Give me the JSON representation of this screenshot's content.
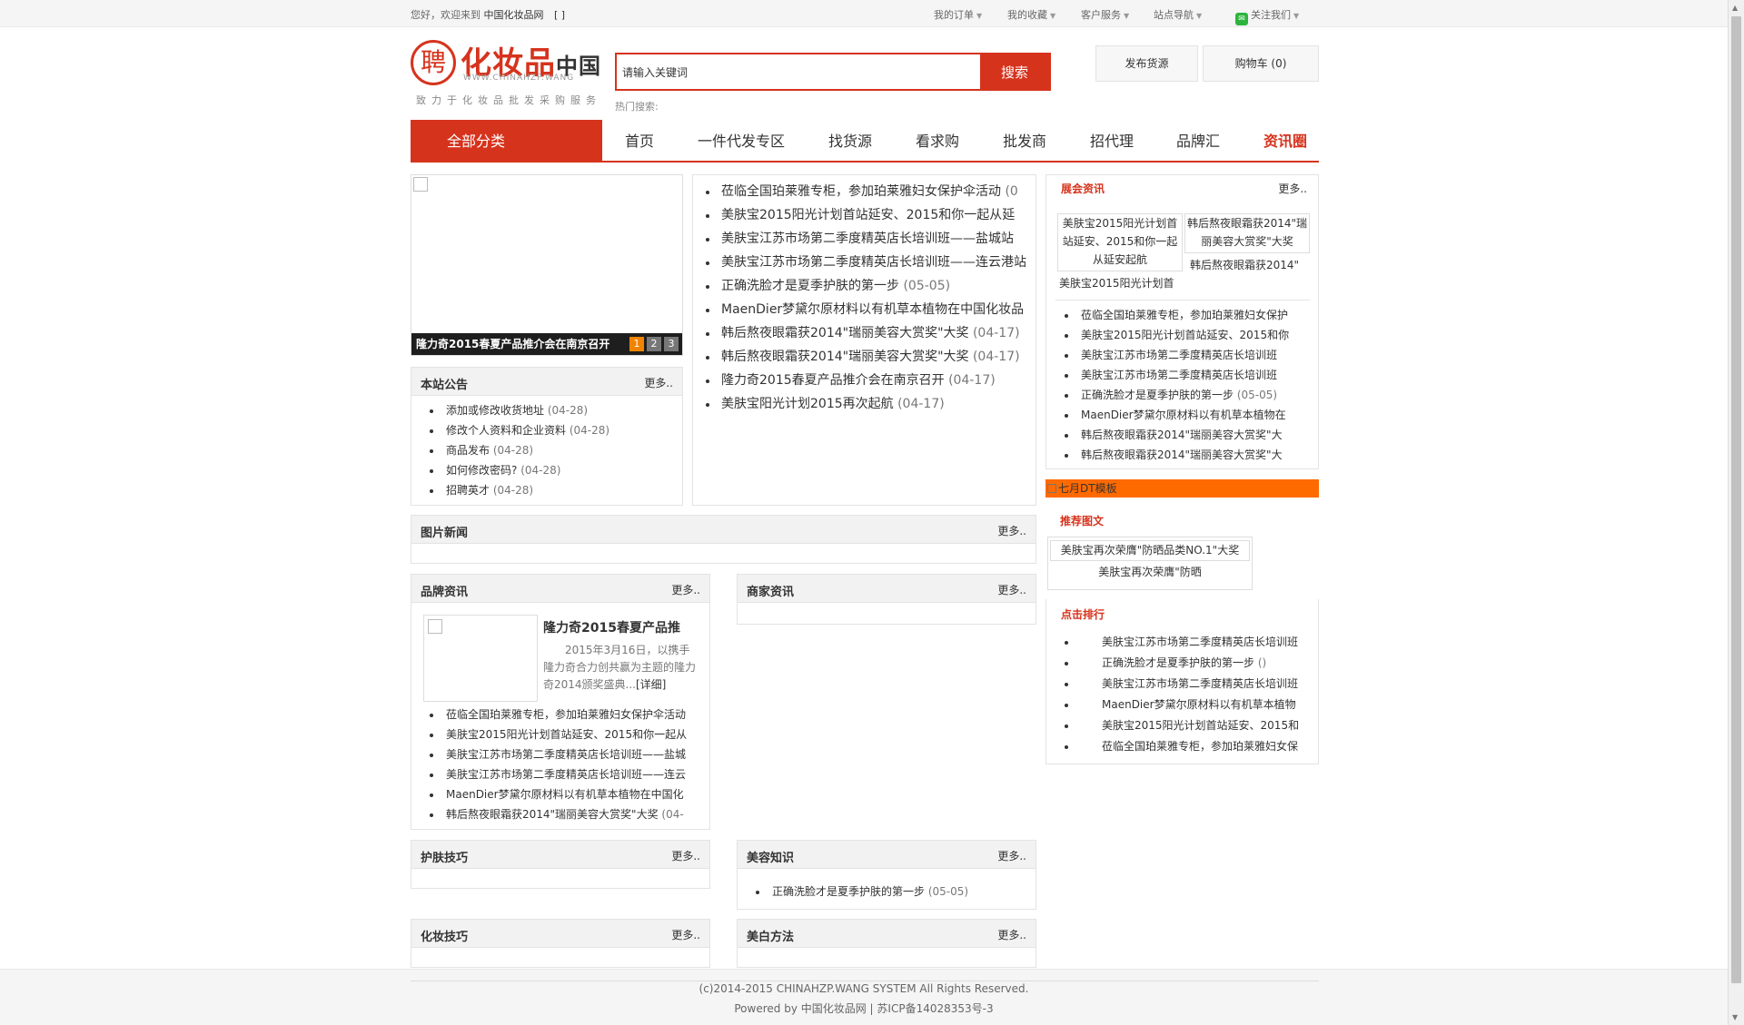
{
  "topbar": {
    "welcome": "您好，欢迎来到",
    "site": "中国化妆品网",
    "bracket": "[ ]",
    "links": [
      "我的订单",
      "我的收藏",
      "客户服务",
      "站点导航",
      "关注我们"
    ]
  },
  "logo": {
    "seal": "聘",
    "cn": "化妆品",
    "cn2": "中国",
    "en": "WWW.CHINAHZP.WANG",
    "slogan": "致力于化妆品批发采购服务"
  },
  "search": {
    "placeholder": "请输入关键词",
    "button": "搜索",
    "hot_label": "热门搜索:"
  },
  "header_buttons": {
    "publish": "发布货源",
    "cart": "购物车 (0)"
  },
  "nav": {
    "all": "全部分类",
    "items": [
      "首页",
      "一件代发专区",
      "找货源",
      "看求购",
      "批发商",
      "招代理",
      "品牌汇",
      "资讯圈"
    ]
  },
  "slider": {
    "caption": "隆力奇2015春夏产品推介会在南京召开",
    "pages": [
      "1",
      "2",
      "3"
    ]
  },
  "notice": {
    "title": "本站公告",
    "more": "更多..",
    "items": [
      {
        "t": "添加或修改收货地址",
        "d": "(04-28)"
      },
      {
        "t": "修改个人资料和企业资料",
        "d": "(04-28)"
      },
      {
        "t": "商品发布",
        "d": "(04-28)"
      },
      {
        "t": "如何修改密码?",
        "d": "(04-28)"
      },
      {
        "t": "招聘英才",
        "d": "(04-28)"
      }
    ]
  },
  "news": [
    {
      "t": "莅临全国珀莱雅专柜，参加珀莱雅妇女保护伞活动",
      "d": "(0"
    },
    {
      "t": "美肤宝2015阳光计划首站延安、2015和你一起从延",
      "d": ""
    },
    {
      "t": "美肤宝江苏市场第二季度精英店长培训班——盐城站",
      "d": ""
    },
    {
      "t": "美肤宝江苏市场第二季度精英店长培训班——连云港站",
      "d": ""
    },
    {
      "t": "正确洗脸才是夏季护肤的第一步",
      "d": "(05-05)"
    },
    {
      "t": "MaenDier梦黛尔原材料以有机草本植物在中国化妆品",
      "d": ""
    },
    {
      "t": "韩后熬夜眼霜获2014\"瑞丽美容大赏奖\"大奖",
      "d": "(04-17)"
    },
    {
      "t": "韩后熬夜眼霜获2014\"瑞丽美容大赏奖\"大奖",
      "d": "(04-17)"
    },
    {
      "t": "隆力奇2015春夏产品推介会在南京召开",
      "d": "(04-17)"
    },
    {
      "t": "美肤宝阳光计划2015再次起航",
      "d": "(04-17)"
    }
  ],
  "picnews": {
    "title": "图片新闻",
    "more": "更多.."
  },
  "brand": {
    "title": "品牌资讯",
    "more": "更多..",
    "feat_title": "隆力奇2015春夏产品推",
    "feat_text": "2015年3月16日，以携手隆力奇合力创共赢为主题的隆力奇2014颁奖盛典...",
    "feat_link": "[详细]",
    "items": [
      {
        "t": "莅临全国珀莱雅专柜，参加珀莱雅妇女保护伞活动",
        "d": ""
      },
      {
        "t": "美肤宝2015阳光计划首站延安、2015和你一起从",
        "d": ""
      },
      {
        "t": "美肤宝江苏市场第二季度精英店长培训班——盐城",
        "d": ""
      },
      {
        "t": "美肤宝江苏市场第二季度精英店长培训班——连云",
        "d": ""
      },
      {
        "t": "MaenDier梦黛尔原材料以有机草本植物在中国化",
        "d": ""
      },
      {
        "t": "韩后熬夜眼霜获2014\"瑞丽美容大赏奖\"大奖",
        "d": "(04-"
      }
    ]
  },
  "merchant": {
    "title": "商家资讯",
    "more": "更多.."
  },
  "skincare": {
    "title": "护肤技巧",
    "more": "更多.."
  },
  "beauty": {
    "title": "美容知识",
    "more": "更多..",
    "items": [
      {
        "t": "正确洗脸才是夏季护肤的第一步",
        "d": "(05-05)"
      }
    ]
  },
  "makeup": {
    "title": "化妆技巧",
    "more": "更多.."
  },
  "whitening": {
    "title": "美白方法",
    "more": "更多.."
  },
  "right": {
    "expo": {
      "title": "展会资讯",
      "more": "更多..",
      "thumb1_alt": "美肤宝2015阳光计划首站延安、2015和你一起从延安起航",
      "thumb1_cap": "美肤宝2015阳光计划首",
      "thumb2_alt": "韩后熬夜眼霜获2014\"瑞丽美容大赏奖\"大奖",
      "thumb2_cap": "韩后熬夜眼霜获2014\"",
      "items": [
        {
          "t": "莅临全国珀莱雅专柜，参加珀莱雅妇女保护",
          "d": ""
        },
        {
          "t": "美肤宝2015阳光计划首站延安、2015和你",
          "d": ""
        },
        {
          "t": "美肤宝江苏市场第二季度精英店长培训班",
          "d": ""
        },
        {
          "t": "美肤宝江苏市场第二季度精英店长培训班",
          "d": ""
        },
        {
          "t": "正确洗脸才是夏季护肤的第一步",
          "d": "(05-05)"
        },
        {
          "t": "MaenDier梦黛尔原材料以有机草本植物在",
          "d": ""
        },
        {
          "t": "韩后熬夜眼霜获2014\"瑞丽美容大赏奖\"大",
          "d": ""
        },
        {
          "t": "韩后熬夜眼霜获2014\"瑞丽美容大赏奖\"大",
          "d": ""
        }
      ]
    },
    "banner": "七月DT模板",
    "recommend": {
      "title": "推荐图文",
      "alt": "美肤宝再次荣膺\"防晒品类NO.1\"大奖",
      "cap": "美肤宝再次荣膺\"防晒"
    },
    "ranking": {
      "title": "点击排行",
      "items": [
        {
          "t": "美肤宝江苏市场第二季度精英店长培训班",
          "d": ""
        },
        {
          "t": "正确洗脸才是夏季护肤的第一步",
          "d": "()"
        },
        {
          "t": "美肤宝江苏市场第二季度精英店长培训班",
          "d": ""
        },
        {
          "t": "MaenDier梦黛尔原材料以有机草本植物",
          "d": ""
        },
        {
          "t": "美肤宝2015阳光计划首站延安、2015和",
          "d": ""
        },
        {
          "t": "莅临全国珀莱雅专柜，参加珀莱雅妇女保",
          "d": ""
        }
      ]
    }
  },
  "footer": {
    "copyright": "(c)2014-2015 CHINAHZP.WANG SYSTEM All Rights Reserved.",
    "powered": "Powered by 中国化妆品网 | 苏ICP备14028353号-3"
  },
  "colors": {
    "accent": "#d6331d",
    "banner": "#ff6a00"
  }
}
